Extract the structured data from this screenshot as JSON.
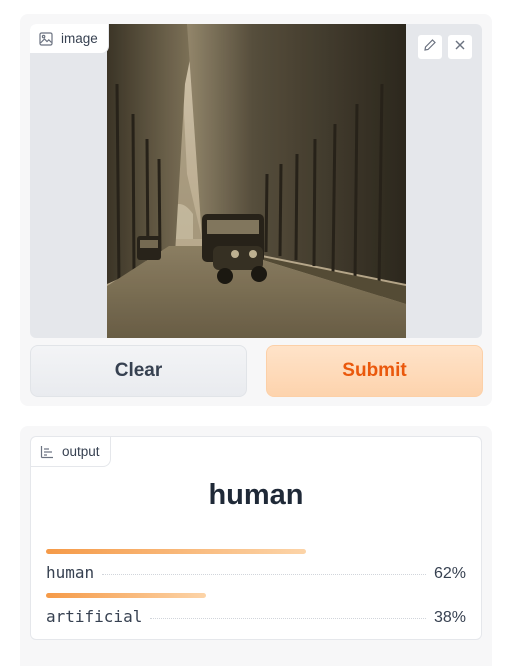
{
  "input": {
    "image_label": "image",
    "label_icon": "image-icon",
    "edit_icon": "pencil-icon",
    "close_icon": "close-icon",
    "clear_label": "Clear",
    "submit_label": "Submit",
    "accent_color": "#ea580c"
  },
  "output": {
    "block_label": "output",
    "label_icon": "bar-chart-icon",
    "top_label": "human",
    "confidences": [
      {
        "label": "human",
        "percent_text": "62%",
        "fraction": 0.62
      },
      {
        "label": "artificial",
        "percent_text": "38%",
        "fraction": 0.38
      }
    ]
  }
}
